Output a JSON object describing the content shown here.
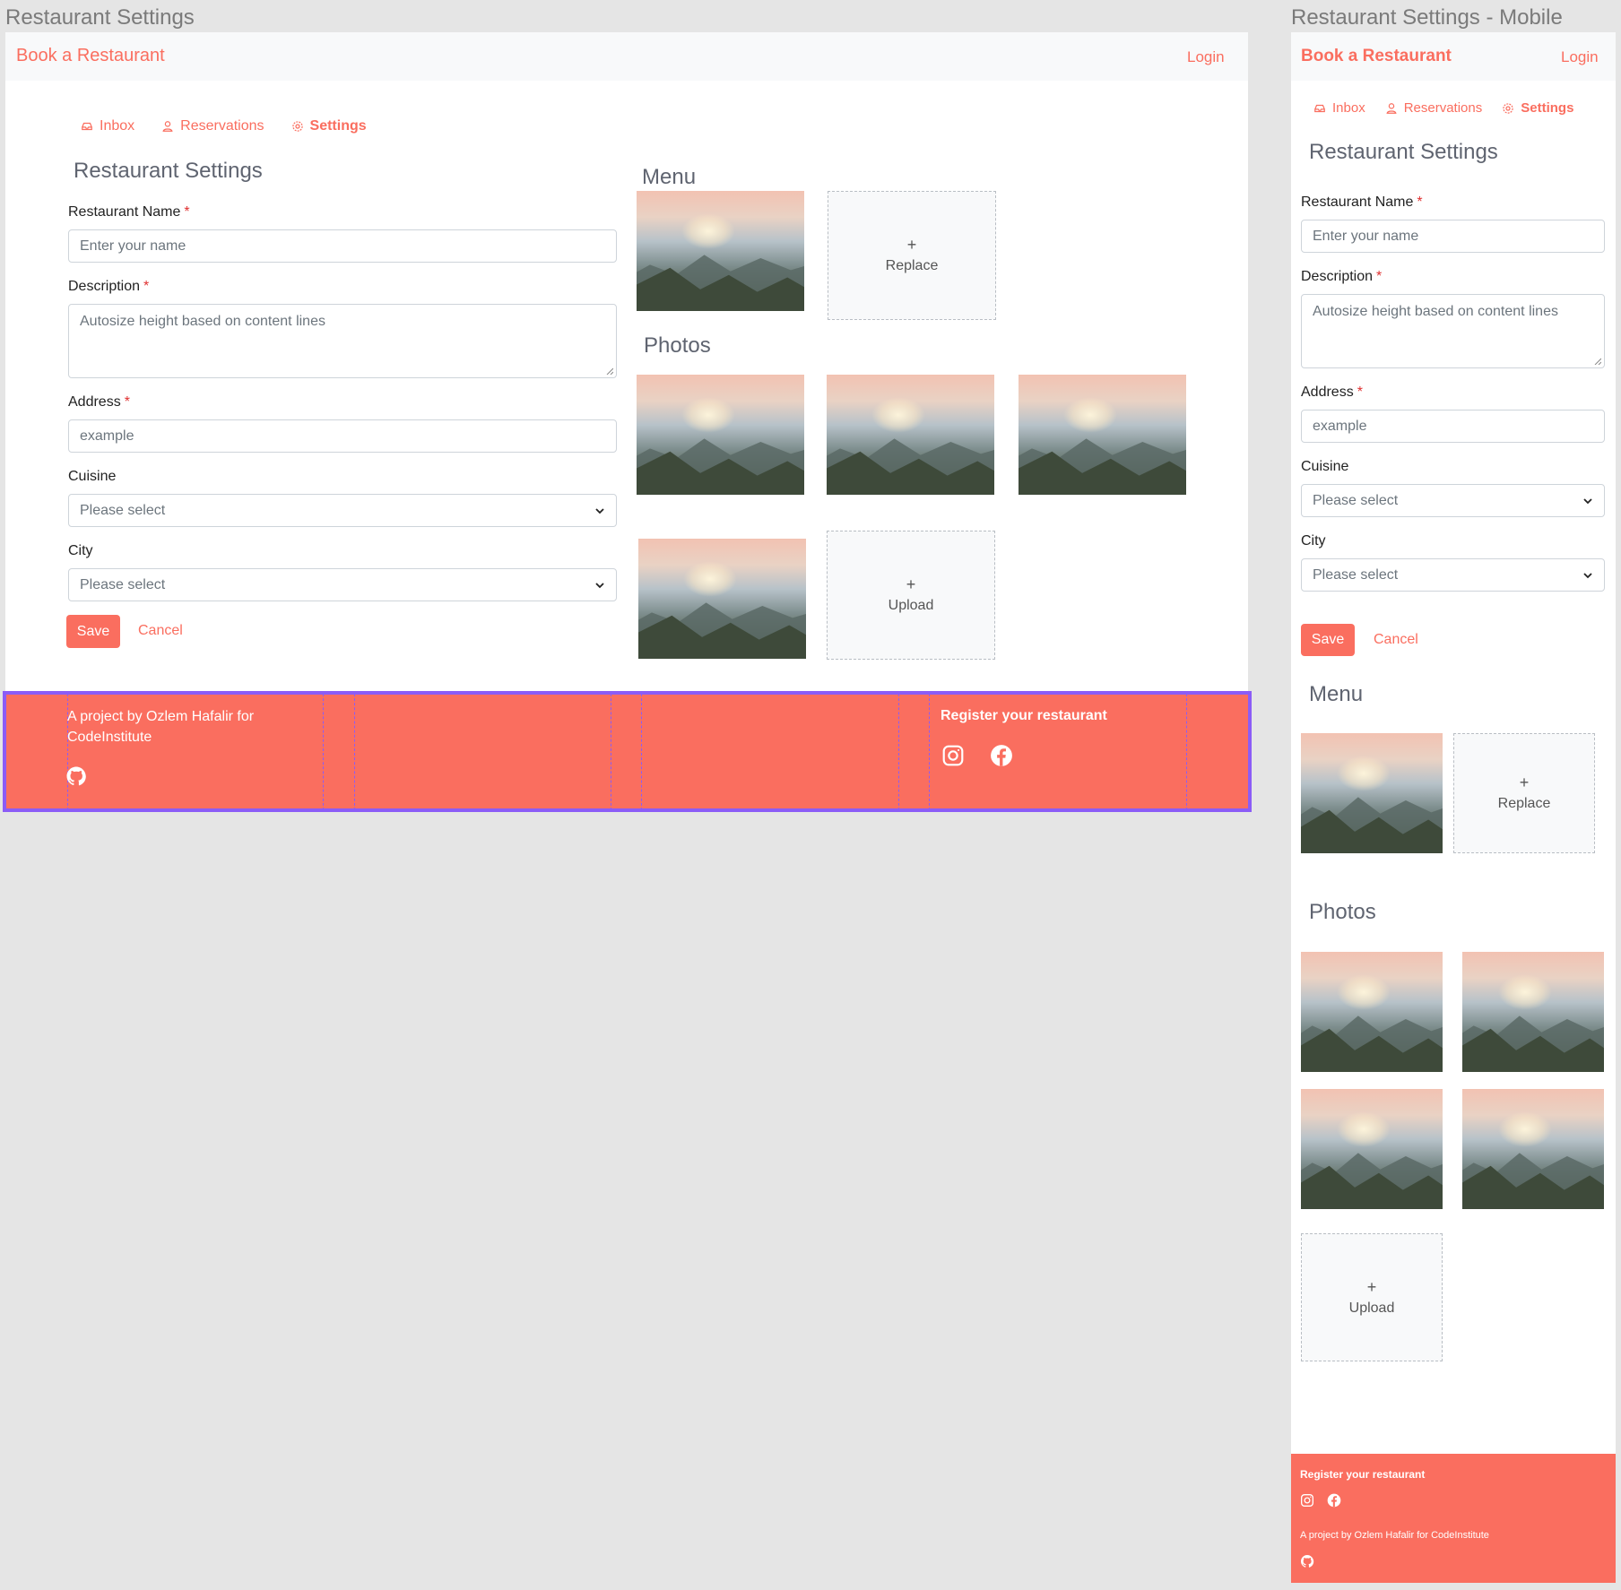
{
  "desktop": {
    "frame_title": "Restaurant Settings",
    "brand": "Book a Restaurant",
    "login": "Login",
    "tabs": [
      {
        "label": "Inbox",
        "icon": "inbox-icon"
      },
      {
        "label": "Reservations",
        "icon": "user-icon"
      },
      {
        "label": "Settings",
        "icon": "gear-icon",
        "active": true
      }
    ],
    "page_title": "Restaurant Settings",
    "form": {
      "name_label": "Restaurant Name",
      "name_placeholder": "Enter your name",
      "description_label": "Description",
      "description_placeholder": "Autosize height based on content lines",
      "address_label": "Address",
      "address_placeholder": "example",
      "cuisine_label": "Cuisine",
      "cuisine_value": "Please select",
      "city_label": "City",
      "city_value": "Please select",
      "required_mark": "*",
      "save": "Save",
      "cancel": "Cancel"
    },
    "menu_title": "Menu",
    "replace_label": "Replace",
    "photos_title": "Photos",
    "upload_label": "Upload",
    "plus": "+",
    "footer": {
      "project_text": "A project by Ozlem Hafalir for CodeInstitute",
      "register": "Register your restaurant"
    }
  },
  "mobile": {
    "frame_title": "Restaurant Settings - Mobile",
    "brand": "Book a Restaurant",
    "login": "Login",
    "tabs": [
      {
        "label": "Inbox",
        "icon": "inbox-icon"
      },
      {
        "label": "Reservations",
        "icon": "user-icon"
      },
      {
        "label": "Settings",
        "icon": "gear-icon",
        "active": true
      }
    ],
    "page_title": "Restaurant Settings",
    "form": {
      "name_label": "Restaurant Name",
      "name_placeholder": "Enter your name",
      "description_label": "Description",
      "description_placeholder": "Autosize height based on content lines",
      "address_label": "Address",
      "address_placeholder": "example",
      "cuisine_label": "Cuisine",
      "cuisine_value": "Please select",
      "city_label": "City",
      "city_value": "Please select",
      "required_mark": "*",
      "save": "Save",
      "cancel": "Cancel"
    },
    "menu_title": "Menu",
    "replace_label": "Replace",
    "photos_title": "Photos",
    "upload_label": "Upload",
    "plus": "+",
    "footer": {
      "register": "Register your restaurant",
      "project_text": "A project by Ozlem Hafalir for CodeInstitute"
    }
  },
  "colors": {
    "accent": "#fa6e5f",
    "selection": "#8b5cf6",
    "canvas": "#e5e5e5"
  }
}
